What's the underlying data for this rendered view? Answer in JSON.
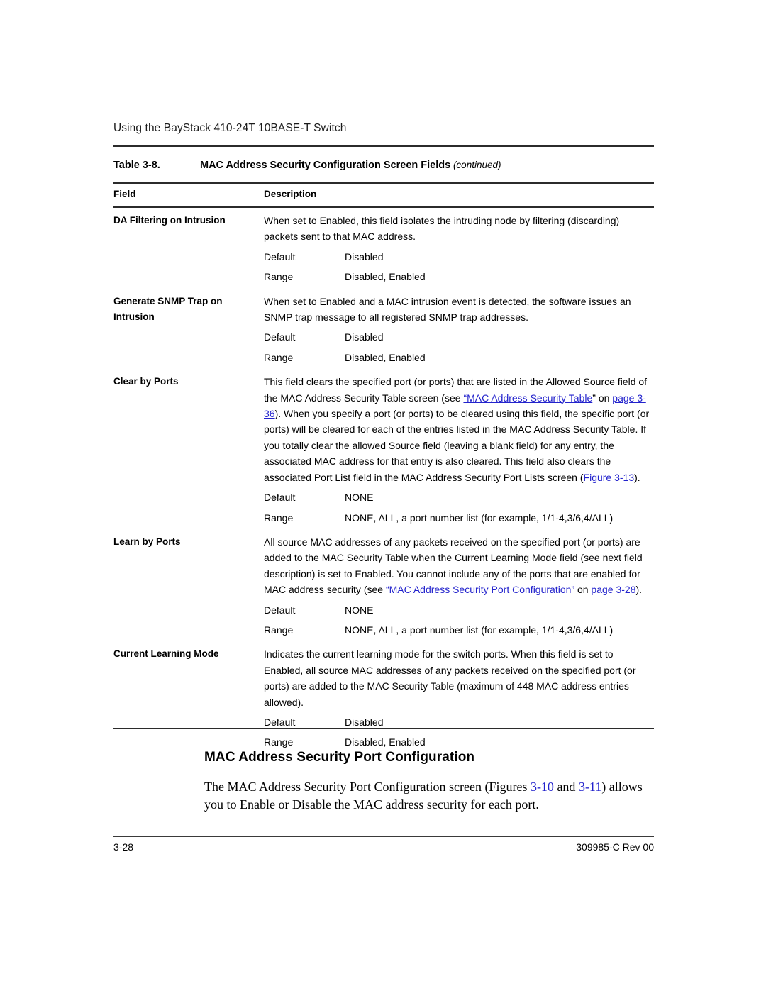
{
  "page": {
    "running_head": "Using the BayStack 410-24T 10BASE-T Switch",
    "footer_page_number": "3-28",
    "footer_doc_id": "309985-C Rev 00"
  },
  "table": {
    "caption_label": "Table 3-8.",
    "caption_title": "MAC Address Security Configuration Screen Fields",
    "caption_continued": "(continued)",
    "columns": {
      "field": "Field",
      "description": "Description"
    },
    "labels": {
      "default": "Default",
      "range": "Range"
    },
    "rows": [
      {
        "field": "DA Filtering on Intrusion",
        "description": "When set to Enabled, this field isolates the intruding node by filtering (discarding) packets sent to that MAC address.",
        "default": "Disabled",
        "range": "Disabled, Enabled"
      },
      {
        "field": "Generate SNMP Trap on Intrusion",
        "description": "When set to Enabled and a MAC intrusion event is detected, the software issues an SNMP trap message to all registered SNMP trap addresses.",
        "default": "Disabled",
        "range": "Disabled, Enabled"
      },
      {
        "field": "Clear by Ports",
        "desc_part1": "This field clears the specified port (or ports) that are listed in the Allowed Source field of the MAC Address Security Table screen (see ",
        "link1": "“MAC Address Security Table",
        "desc_part2": "” on ",
        "link2": "page 3-36",
        "desc_part3": "). When you specify a port (or ports) to be cleared using this field, the specific port (or ports) will be cleared for each of the entries listed in the MAC Address Security Table. If you totally clear the allowed Source field (leaving a blank field) for any entry, the associated MAC address for that entry is also cleared. This field also clears the associated Port List field in the MAC Address Security Port Lists screen (",
        "link3": "Figure 3-13",
        "desc_part4": ").",
        "default": "NONE",
        "range": "NONE, ALL, a port number list (for example, 1/1-4,3/6,4/ALL)"
      },
      {
        "field": "Learn by Ports",
        "desc_part1": "All source MAC addresses of any packets received on the specified port (or ports) are added to the MAC Security Table when the Current Learning Mode field (see next field description) is set to Enabled. You cannot include any of the ports that are enabled for MAC address security (see ",
        "link1": "“MAC Address Security Port Configuration”",
        "desc_part2": " on ",
        "link2": "page 3-28",
        "desc_part3": ").",
        "default": "NONE",
        "range": "NONE, ALL, a port number list (for example, 1/1-4,3/6,4/ALL)"
      },
      {
        "field": "Current Learning Mode",
        "description": "Indicates the current learning mode for the switch ports. When this field is set to Enabled, all source MAC addresses of any packets received on the specified port (or ports) are added to the MAC Security Table (maximum of 448 MAC address entries allowed).",
        "default": "Disabled",
        "range": "Disabled, Enabled"
      }
    ]
  },
  "section": {
    "heading": "MAC Address Security Port Configuration",
    "para_part1": "The MAC Address Security Port Configuration screen (Figures ",
    "para_link1": "3-10",
    "para_part2": " and ",
    "para_link2": "3-11",
    "para_part3": ") allows you to Enable or Disable the MAC address security for each port."
  },
  "colors": {
    "link": "#2222cc",
    "rule": "#2b2b2b",
    "text": "#000000"
  }
}
